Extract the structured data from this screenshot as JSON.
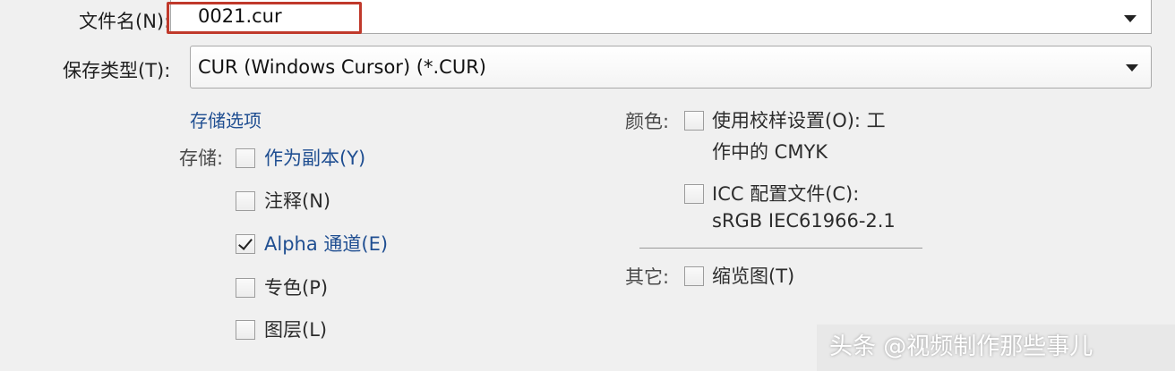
{
  "filename": {
    "label": "文件名(N):",
    "value": "0021.cur"
  },
  "save_type": {
    "label": "保存类型(T):",
    "value": "CUR (Windows Cursor) (*.CUR)"
  },
  "storage_options": {
    "title": "存储选项",
    "save_label": "存储:",
    "items": [
      {
        "label": "作为副本(Y)",
        "checked": false
      },
      {
        "label": "注释(N)",
        "checked": false
      },
      {
        "label": "Alpha 通道(E)",
        "checked": true
      },
      {
        "label": "专色(P)",
        "checked": false
      },
      {
        "label": "图层(L)",
        "checked": false
      }
    ]
  },
  "color": {
    "label": "颜色:",
    "use_proof": {
      "line1": "使用校样设置(O):  工",
      "line2": "作中的 CMYK",
      "checked": false
    },
    "icc": {
      "line1": "ICC 配置文件(C):",
      "line2": "sRGB IEC61966-2.1",
      "checked": false
    }
  },
  "other": {
    "label": "其它:",
    "thumbnail": {
      "label": "缩览图(T)",
      "checked": false
    }
  },
  "watermark": "头条 @视频制作那些事儿",
  "colors": {
    "accent_text": "#1f4e91",
    "highlight_border": "#c0392b"
  }
}
